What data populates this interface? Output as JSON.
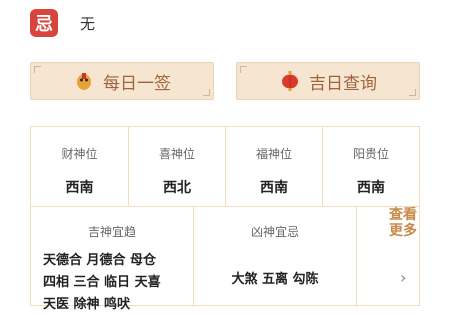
{
  "ji": {
    "badge": "忌",
    "text": "无"
  },
  "buttons": [
    {
      "label": "每日一签"
    },
    {
      "label": "吉日查询"
    }
  ],
  "gods": [
    {
      "title": "财神位",
      "value": "西南"
    },
    {
      "title": "喜神位",
      "value": "西北"
    },
    {
      "title": "福神位",
      "value": "西南"
    },
    {
      "title": "阳贵位",
      "value": "西南"
    }
  ],
  "auspicious": {
    "title": "吉神宜趋",
    "lines": [
      "天德合 月德合 母仓",
      "四相 三合 临日 天喜",
      "天医 除神 鸣吠"
    ]
  },
  "inauspicious": {
    "title": "凶神宜忌",
    "line": "大煞 五离 勾陈"
  },
  "more_label": "查看更多",
  "colors": {
    "badge": "#d8453c",
    "button_bg": "#f6e6d1",
    "button_text": "#a0633a",
    "border": "#f0dcc4"
  }
}
